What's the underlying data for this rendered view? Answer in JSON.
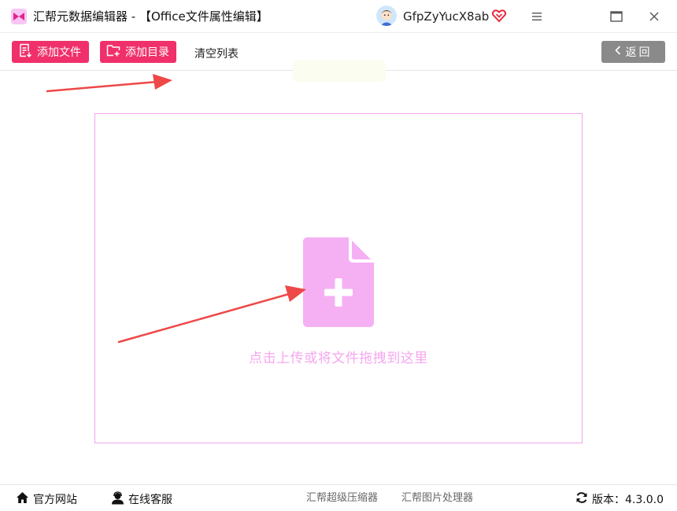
{
  "window": {
    "title": "汇帮元数据编辑器 - 【Office文件属性编辑】",
    "username": "GfpZyYucX8ab"
  },
  "toolbar": {
    "add_file": "添加文件",
    "add_dir": "添加目录",
    "clear_list": "清空列表",
    "back": "返回"
  },
  "dropzone": {
    "hint": "点击上传或将文件拖拽到这里"
  },
  "footer": {
    "official_site": "官方网站",
    "online_service": "在线客服",
    "compressor": "汇帮超级压缩器",
    "image_tool": "汇帮图片处理器",
    "version_label": "版本：",
    "version_value": "4.3.0.0"
  },
  "colors": {
    "accent": "#f0306a",
    "back_button": "#8a8a8a",
    "drop_border": "#f2a6ee",
    "drop_icon": "#f5b0f4",
    "annotation_arrow": "#ee4848"
  },
  "icons": {
    "app_logo": "app-logo-icon",
    "vip": "heart-diamond-icon",
    "menu": "hamburger-menu-icon",
    "maximize": "maximize-icon",
    "close": "close-icon",
    "add_file": "file-list-icon",
    "add_dir": "folder-plus-icon",
    "back": "chevron-left-icon",
    "drop": "file-plus-icon",
    "home": "home-icon",
    "service": "user-headset-icon",
    "refresh": "refresh-icon"
  }
}
